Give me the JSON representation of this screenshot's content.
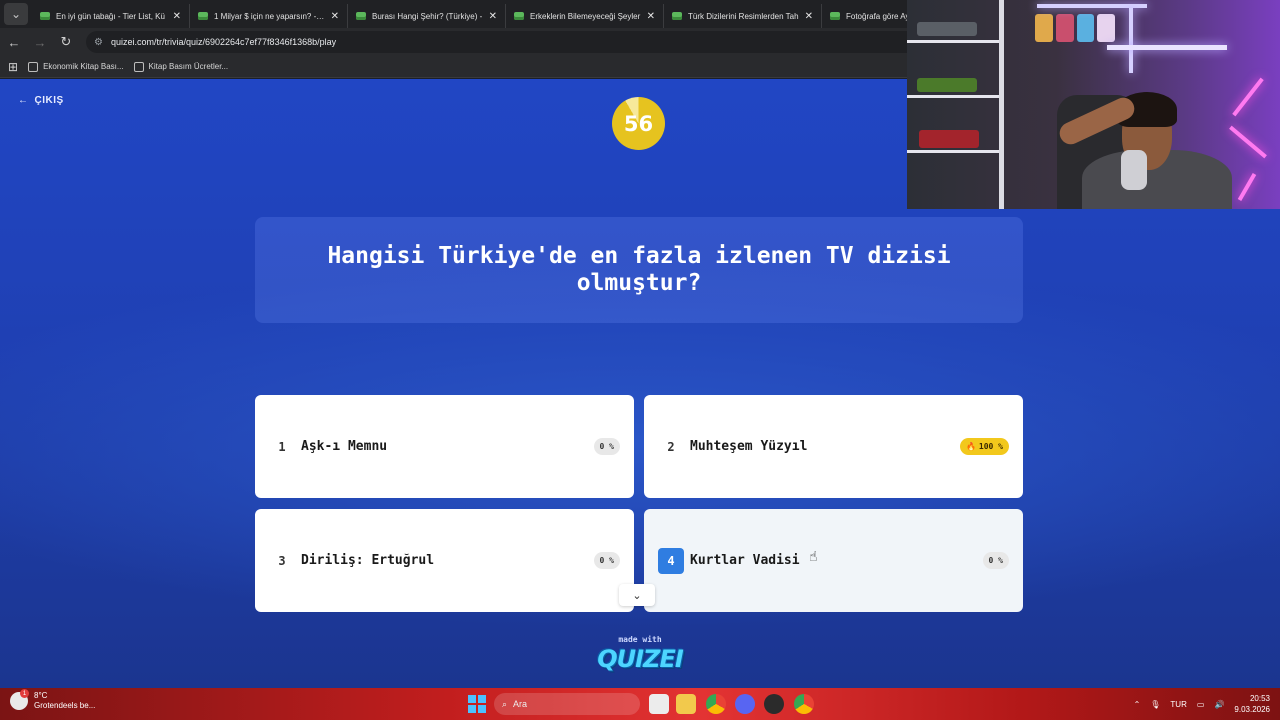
{
  "browser": {
    "tabs": [
      {
        "title": "En iyi gün tabağı - Tier List, Kü"
      },
      {
        "title": "1 Milyar $ için ne yaparsın? - Ti"
      },
      {
        "title": "Burası Hangi Şehir? (Türkiye) -"
      },
      {
        "title": "Erkeklerin Bilemeyeceği Şeyler"
      },
      {
        "title": "Türk Dizilerini Resimlerden Tah"
      },
      {
        "title": "Fotoğrafa göre Ayk"
      }
    ],
    "url": "quizei.com/tr/trivia/quiz/6902264c7ef77f8346f1368b/play",
    "bookmarks": [
      {
        "label": "Ekonomik Kitap Bası..."
      },
      {
        "label": "Kitap Basım Ücretler..."
      }
    ]
  },
  "quiz": {
    "exit_label": "ÇIKIŞ",
    "timer": "56",
    "question": "Hangisi Türkiye'de en fazla izlenen TV dizisi olmuştur?",
    "answers": [
      {
        "num": "1",
        "text": "Aşk-ı Memnu",
        "pct": "0 %"
      },
      {
        "num": "2",
        "text": "Muhteşem Yüzyıl",
        "pct": "100 %"
      },
      {
        "num": "3",
        "text": "Diriliş: Ertuğrul",
        "pct": "0 %"
      },
      {
        "num": "4",
        "text": "Kurtlar Vadisi",
        "pct": "0 %"
      }
    ],
    "made_with": "made with",
    "logo": "QUIZEI"
  },
  "taskbar": {
    "weather_temp": "8°C",
    "weather_desc": "Grotendeels be...",
    "weather_badge": "1",
    "search_placeholder": "Ara",
    "language": "TUR",
    "time": "20:53",
    "date": "9.03.2026"
  }
}
